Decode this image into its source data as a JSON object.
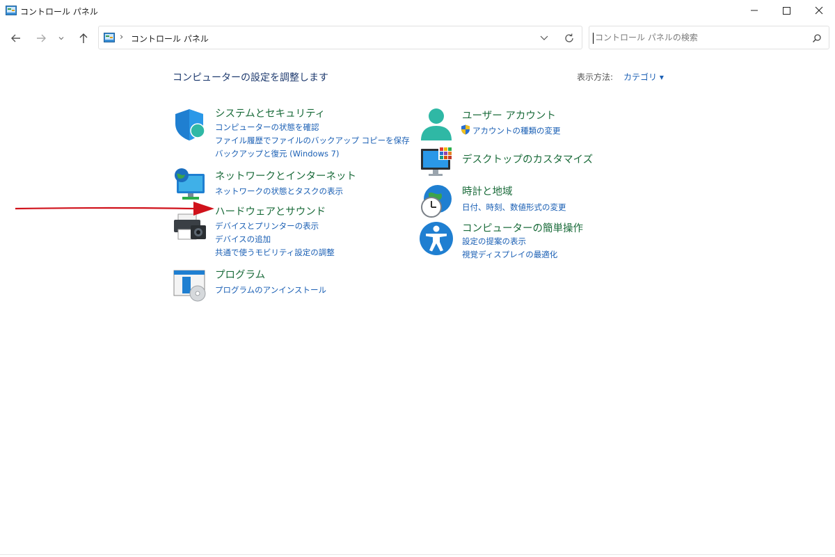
{
  "window": {
    "title": "コントロール パネル",
    "controls": {
      "minimize": "minimize",
      "maximize": "maximize",
      "close": "close"
    }
  },
  "toolbar": {
    "breadcrumb": "コントロール パネル",
    "search_placeholder": "コントロール パネルの検索"
  },
  "main": {
    "heading": "コンピューターの設定を調整します",
    "view_by_label": "表示方法:",
    "view_by_value": "カテゴリ ▾"
  },
  "categories": [
    {
      "icon": "security-shield-icon",
      "title": "システムとセキュリティ",
      "links": [
        "コンピューターの状態を確認",
        "ファイル履歴でファイルのバックアップ コピーを保存",
        "バックアップと復元 (Windows 7)"
      ]
    },
    {
      "icon": "network-globe-icon",
      "title": "ネットワークとインターネット",
      "links": [
        "ネットワークの状態とタスクの表示"
      ]
    },
    {
      "icon": "printer-camera-icon",
      "title": "ハードウェアとサウンド",
      "links": [
        "デバイスとプリンターの表示",
        "デバイスの追加",
        "共通で使うモビリティ設定の調整"
      ]
    },
    {
      "icon": "program-box-icon",
      "title": "プログラム",
      "links": [
        "プログラムのアンインストール"
      ]
    },
    {
      "icon": "user-account-icon",
      "title": "ユーザー アカウント",
      "links": [
        "アカウントの種類の変更"
      ]
    },
    {
      "icon": "desktop-monitor-icon",
      "title": "デスクトップのカスタマイズ",
      "links": []
    },
    {
      "icon": "clock-globe-icon",
      "title": "時計と地域",
      "links": [
        "日付、時刻、数値形式の変更"
      ]
    },
    {
      "icon": "accessibility-icon",
      "title": "コンピューターの簡単操作",
      "links": [
        "設定の提案の表示",
        "視覚ディスプレイの最適化"
      ]
    }
  ],
  "colors": {
    "category_title": "#1a6b3a",
    "link": "#1a5fb4",
    "heading": "#1e3a6e",
    "annotation_arrow": "#d0121b"
  }
}
